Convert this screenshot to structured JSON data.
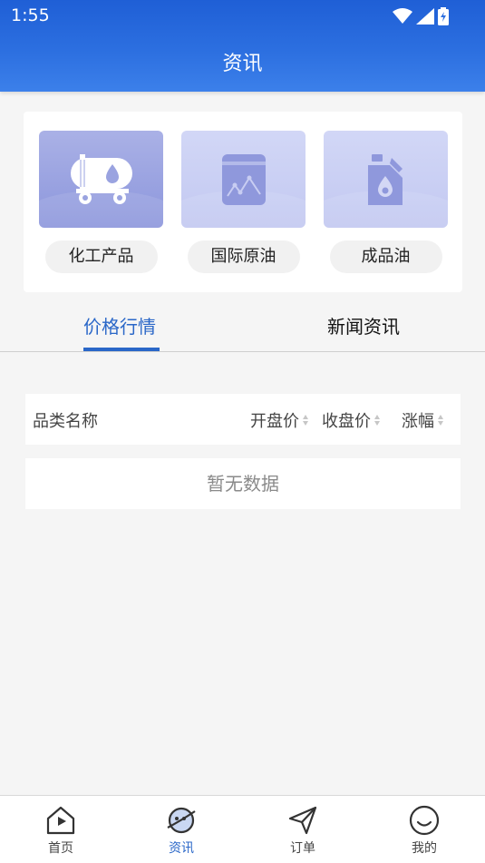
{
  "status_bar": {
    "time": "1:55"
  },
  "header": {
    "title": "资讯"
  },
  "categories": [
    {
      "label": "化工产品",
      "icon": "tanker-truck-icon"
    },
    {
      "label": "国际原油",
      "icon": "price-chart-icon"
    },
    {
      "label": "成品油",
      "icon": "oil-can-icon"
    }
  ],
  "tabs": [
    {
      "label": "价格行情",
      "active": true
    },
    {
      "label": "新闻资讯",
      "active": false
    }
  ],
  "table": {
    "columns": [
      "品类名称",
      "开盘价",
      "收盘价",
      "涨幅"
    ],
    "empty_text": "暂无数据"
  },
  "bottom_nav": [
    {
      "label": "首页",
      "icon": "home-icon"
    },
    {
      "label": "资讯",
      "icon": "planet-icon",
      "active": true
    },
    {
      "label": "订单",
      "icon": "send-icon"
    },
    {
      "label": "我的",
      "icon": "smile-icon"
    }
  ],
  "colors": {
    "primary": "#2a67c8",
    "header_top": "#1f5fd6",
    "header_bottom": "#3c80ea"
  }
}
